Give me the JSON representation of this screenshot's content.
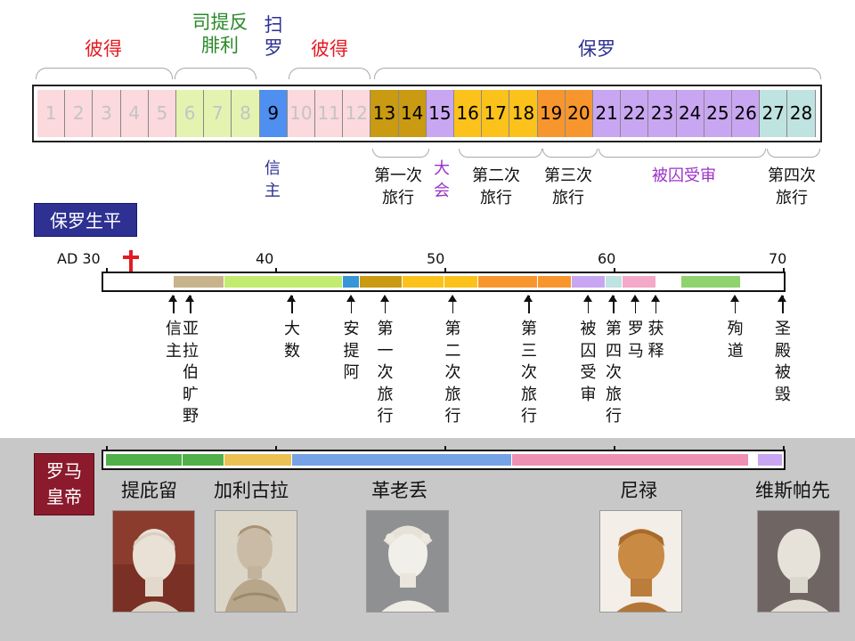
{
  "top_labels": [
    {
      "text": "彼得",
      "color": "#e31b23"
    },
    {
      "text": "司提反\n腓利",
      "color": "#2a8a2a"
    },
    {
      "text": "扫\n罗",
      "color": "#2e3192"
    },
    {
      "text": "彼得",
      "color": "#e31b23"
    },
    {
      "text": "保罗",
      "color": "#2e3192"
    }
  ],
  "chapters": [
    {
      "n": "1",
      "color": "#fbd9dc",
      "faded": true
    },
    {
      "n": "2",
      "color": "#fbd9dc",
      "faded": true
    },
    {
      "n": "3",
      "color": "#fbd9dc",
      "faded": true
    },
    {
      "n": "4",
      "color": "#fbd9dc",
      "faded": true
    },
    {
      "n": "5",
      "color": "#fbd9dc",
      "faded": true
    },
    {
      "n": "6",
      "color": "#e4f3b0",
      "faded": true
    },
    {
      "n": "7",
      "color": "#e4f3b0",
      "faded": true
    },
    {
      "n": "8",
      "color": "#e4f3b0",
      "faded": true
    },
    {
      "n": "9",
      "color": "#4f8ff0",
      "faded": false
    },
    {
      "n": "10",
      "color": "#fbd9dc",
      "faded": true
    },
    {
      "n": "11",
      "color": "#fbd9dc",
      "faded": true
    },
    {
      "n": "12",
      "color": "#fbd9dc",
      "faded": true
    },
    {
      "n": "13",
      "color": "#c99a12",
      "faded": false
    },
    {
      "n": "14",
      "color": "#c99a12",
      "faded": false
    },
    {
      "n": "15",
      "color": "#c9a6f2",
      "faded": false
    },
    {
      "n": "16",
      "color": "#fbc21c",
      "faded": false
    },
    {
      "n": "17",
      "color": "#fbc21c",
      "faded": false
    },
    {
      "n": "18",
      "color": "#fbc21c",
      "faded": false
    },
    {
      "n": "19",
      "color": "#f8962e",
      "faded": false
    },
    {
      "n": "20",
      "color": "#f8962e",
      "faded": false
    },
    {
      "n": "21",
      "color": "#c9a6f2",
      "faded": false
    },
    {
      "n": "22",
      "color": "#c9a6f2",
      "faded": false
    },
    {
      "n": "23",
      "color": "#c9a6f2",
      "faded": false
    },
    {
      "n": "24",
      "color": "#c9a6f2",
      "faded": false
    },
    {
      "n": "25",
      "color": "#c9a6f2",
      "faded": false
    },
    {
      "n": "26",
      "color": "#c9a6f2",
      "faded": false
    },
    {
      "n": "27",
      "color": "#bfe3e0",
      "faded": false
    },
    {
      "n": "28",
      "color": "#bfe3e0",
      "faded": false
    }
  ],
  "chapter_notes": [
    {
      "text": "信\n主",
      "color": "#2e3192"
    },
    {
      "text": "第一次\n旅行",
      "color": "#111111"
    },
    {
      "text": "大\n会",
      "color": "#9b30c8"
    },
    {
      "text": "第二次\n旅行",
      "color": "#111111"
    },
    {
      "text": "第三次\n旅行",
      "color": "#111111"
    },
    {
      "text": "被囚受审",
      "color": "#9b30c8"
    },
    {
      "text": "第四次\n旅行",
      "color": "#111111"
    }
  ],
  "life_title": "保罗生平",
  "ticks": [
    "AD 30",
    "40",
    "50",
    "60",
    "70"
  ],
  "cross_icon": "cross-icon",
  "life_segments": [
    {
      "from": 30,
      "to": 34,
      "color": "#ffffff"
    },
    {
      "from": 34,
      "to": 37,
      "color": "#c8b48c"
    },
    {
      "from": 37,
      "to": 44,
      "color": "#c2ec70"
    },
    {
      "from": 44,
      "to": 45,
      "color": "#3996d6"
    },
    {
      "from": 45,
      "to": 47.5,
      "color": "#c99a12"
    },
    {
      "from": 47.5,
      "to": 50,
      "color": "#fbc21c"
    },
    {
      "from": 50,
      "to": 52,
      "color": "#fbc21c"
    },
    {
      "from": 52,
      "to": 55.5,
      "color": "#f8962e"
    },
    {
      "from": 55.5,
      "to": 57.5,
      "color": "#f8962e"
    },
    {
      "from": 57.5,
      "to": 59.5,
      "color": "#c9a6f2"
    },
    {
      "from": 59.5,
      "to": 60.5,
      "color": "#bfe3e0"
    },
    {
      "from": 60.5,
      "to": 62.5,
      "color": "#f4a9c8"
    },
    {
      "from": 62.5,
      "to": 64,
      "color": "#ffffff"
    },
    {
      "from": 64,
      "to": 67.5,
      "color": "#8fd36e"
    },
    {
      "from": 67.5,
      "to": 70,
      "color": "#ffffff"
    }
  ],
  "life_events": [
    {
      "text": "信主",
      "year": 34
    },
    {
      "text": "亚拉伯旷野",
      "year": 35
    },
    {
      "text": "大数",
      "year": 41
    },
    {
      "text": "安提阿",
      "year": 44.5
    },
    {
      "text": "第一次旅行",
      "year": 46.5
    },
    {
      "text": "第二次旅行",
      "year": 50.5
    },
    {
      "text": "第三次旅行",
      "year": 55
    },
    {
      "text": "被囚受审",
      "year": 58.5
    },
    {
      "text": "第四次旅行",
      "year": 60
    },
    {
      "text": "罗马",
      "year": 61.3
    },
    {
      "text": "获释",
      "year": 62.5
    },
    {
      "text": "殉道",
      "year": 67.2
    },
    {
      "text": "圣殿被毁",
      "year": 70
    }
  ],
  "emperors_title": "罗马\n皇帝",
  "emperor_segments": [
    {
      "from": 30,
      "to": 34.5,
      "color": "#52b04b"
    },
    {
      "from": 34.5,
      "to": 37,
      "color": "#52b04b"
    },
    {
      "from": 37,
      "to": 41,
      "color": "#ecc153"
    },
    {
      "from": 41,
      "to": 54,
      "color": "#76a3e6"
    },
    {
      "from": 54,
      "to": 68,
      "color": "#ee90b3"
    },
    {
      "from": 68,
      "to": 68.5,
      "color": "#ffffff"
    },
    {
      "from": 68.5,
      "to": 70,
      "color": "#c9a6f2"
    }
  ],
  "emperors": [
    {
      "name": "提庇留"
    },
    {
      "name": "加利古拉"
    },
    {
      "name": "革老丢"
    },
    {
      "name": "尼禄"
    },
    {
      "name": "维斯帕先"
    }
  ]
}
